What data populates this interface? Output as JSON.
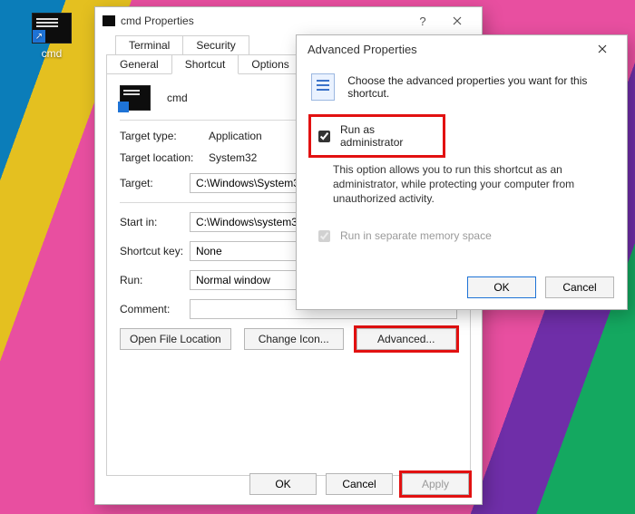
{
  "desktop": {
    "icon_label": "cmd"
  },
  "props_window": {
    "title": "cmd Properties",
    "tabs_top": [
      "Terminal",
      "Security"
    ],
    "tabs_bottom": [
      "General",
      "Shortcut",
      "Options"
    ],
    "active_tab": "Shortcut",
    "header_name": "cmd",
    "rows": {
      "target_type_label": "Target type:",
      "target_type_value": "Application",
      "target_location_label": "Target location:",
      "target_location_value": "System32",
      "target_label": "Target:",
      "target_value": "C:\\Windows\\System32",
      "start_in_label": "Start in:",
      "start_in_value": "C:\\Windows\\system32",
      "shortcut_key_label": "Shortcut key:",
      "shortcut_key_value": "None",
      "run_label": "Run:",
      "run_value": "Normal window",
      "comment_label": "Comment:",
      "comment_value": ""
    },
    "buttons": {
      "open_file_location": "Open File Location",
      "change_icon": "Change Icon...",
      "advanced": "Advanced..."
    },
    "footer": {
      "ok": "OK",
      "cancel": "Cancel",
      "apply": "Apply"
    }
  },
  "adv_dialog": {
    "title": "Advanced Properties",
    "intro": "Choose the advanced properties you want for this shortcut.",
    "run_as_admin_label": "Run as administrator",
    "run_as_admin_checked": true,
    "run_as_admin_desc": "This option allows you to run this shortcut as an administrator, while protecting your computer from unauthorized activity.",
    "separate_mem_label": "Run in separate memory space",
    "separate_mem_checked": true,
    "footer": {
      "ok": "OK",
      "cancel": "Cancel"
    }
  }
}
